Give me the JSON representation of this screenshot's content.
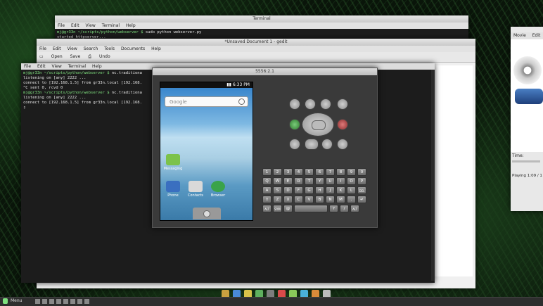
{
  "terminal_top": {
    "title": "Terminal",
    "menu": [
      "File",
      "Edit",
      "View",
      "Terminal",
      "Help"
    ],
    "lines": [
      {
        "prompt": "mj@gr33n ~/scripts/python/webserver $",
        "cmd": " sudo python webserver.py"
      },
      {
        "prompt": "",
        "cmd": "started httpserver..."
      }
    ]
  },
  "gedit": {
    "title": "*Unsaved Document 1 - gedit",
    "menu": [
      "File",
      "Edit",
      "View",
      "Search",
      "Tools",
      "Documents",
      "Help"
    ],
    "toolbar": [
      "Open",
      "Save",
      "Undo"
    ]
  },
  "terminal_main": {
    "menu": [
      "File",
      "Edit",
      "View",
      "Terminal",
      "Help"
    ],
    "lines": [
      {
        "prompt": "mj@gr33n ~/scripts/python/webserver $",
        "cmd": " nc.traditiona"
      },
      {
        "prompt": "",
        "cmd": "listening on [any] 2222 ..."
      },
      {
        "prompt": "",
        "cmd": "connect to [192.168.1.5] from gr33n.local [192.168."
      },
      {
        "prompt": "",
        "cmd": "^C sent 0, rcvd 0"
      },
      {
        "prompt": "mj@gr33n ~/scripts/python/webserver $",
        "cmd": " nc.traditiona"
      },
      {
        "prompt": "",
        "cmd": "listening on [any] 2222 ..."
      },
      {
        "prompt": "",
        "cmd": "connect to [192.168.1.5] from gr33n.local [192.168."
      }
    ]
  },
  "emulator": {
    "title": "5556:2.1",
    "status_time": "6:33 PM",
    "search_placeholder": "Google",
    "apps": {
      "messaging": "Messaging",
      "phone": "Phone",
      "contacts": "Contacts",
      "browser": "Browser"
    },
    "keyboard": [
      [
        "1",
        "2",
        "3",
        "4",
        "5",
        "6",
        "7",
        "8",
        "9",
        "0"
      ],
      [
        "Q",
        "W",
        "E",
        "R",
        "T",
        "Y",
        "U",
        "I",
        "O",
        "P"
      ],
      [
        "A",
        "S",
        "D",
        "F",
        "G",
        "H",
        "J",
        "K",
        "L",
        "DEL"
      ],
      [
        "⇧",
        "Z",
        "X",
        "C",
        "V",
        "B",
        "N",
        "M",
        ".",
        "↵"
      ],
      [
        "ALT",
        "SYM",
        "@",
        "SPACE",
        "?",
        "/",
        "ALT"
      ]
    ]
  },
  "player": {
    "menu": [
      "Movie",
      "Edit"
    ],
    "time_label": "Time:",
    "status": "Playing",
    "position": "1:09 / 1"
  },
  "panel": {
    "menu_label": "Menu"
  },
  "accent": "#7fe07f"
}
